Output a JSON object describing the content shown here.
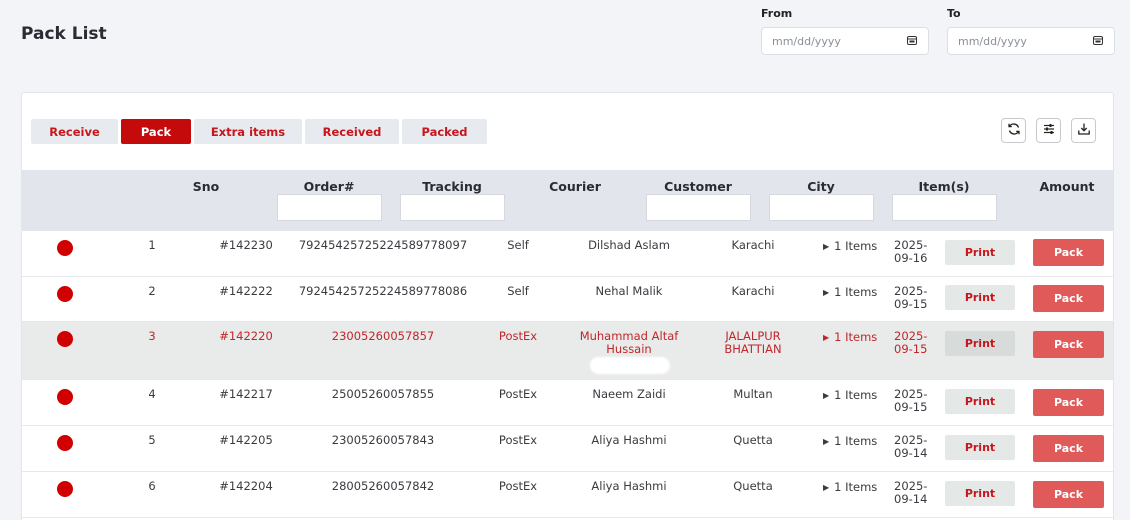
{
  "page": {
    "title": "Pack List"
  },
  "date_filter": {
    "from_label": "From",
    "to_label": "To",
    "from_placeholder": "mm/dd/yyyy",
    "to_placeholder": "mm/dd/yyyy",
    "icon": "calendar-icon"
  },
  "tabs": [
    {
      "label": "Receive",
      "active": false
    },
    {
      "label": "Pack",
      "active": true
    },
    {
      "label": "Extra items",
      "active": false
    },
    {
      "label": "Received",
      "active": false
    },
    {
      "label": "Packed",
      "active": false
    }
  ],
  "toolbar": {
    "icons": [
      "refresh-icon",
      "filter-sliders-icon",
      "download-icon"
    ]
  },
  "table": {
    "columns": [
      "Sno",
      "Order#",
      "Tracking",
      "Courier",
      "Customer",
      "City",
      "Item(s)",
      "Amount"
    ],
    "rows": [
      {
        "sno": "1",
        "order": "#142230",
        "tracking": "7924542572522458977809​7",
        "courier": "Self",
        "customer": "Dilshad Aslam",
        "city": "Karachi",
        "items": "1 Items",
        "date": "2025-\n09-16",
        "print": "Print",
        "pack": "Pack",
        "highlight": false
      },
      {
        "sno": "2",
        "order": "#142222",
        "tracking": "79245425725224589778086",
        "courier": "Self",
        "customer": "Nehal Malik",
        "city": "Karachi",
        "items": "1 Items",
        "date": "2025-\n09-15",
        "print": "Print",
        "pack": "Pack",
        "highlight": false
      },
      {
        "sno": "3",
        "order": "#142220",
        "tracking": "23005260057857",
        "courier": "PostEx",
        "customer": "Muhammad Altaf Hussain",
        "city": "JALALPUR BHATTIAN",
        "items": "1 Items",
        "date": "2025-\n09-15",
        "print": "Print",
        "pack": "Pack",
        "highlight": true
      },
      {
        "sno": "4",
        "order": "#142217",
        "tracking": "25005260057855",
        "courier": "PostEx",
        "customer": "Naeem Zaidi",
        "city": "Multan",
        "items": "1 Items",
        "date": "2025-\n09-15",
        "print": "Print",
        "pack": "Pack",
        "highlight": false
      },
      {
        "sno": "5",
        "order": "#142205",
        "tracking": "23005260057843",
        "courier": "PostEx",
        "customer": "Aliya Hashmi",
        "city": "Quetta",
        "items": "1 Items",
        "date": "2025-\n09-14",
        "print": "Print",
        "pack": "Pack",
        "highlight": false
      },
      {
        "sno": "6",
        "order": "#142204",
        "tracking": "28005260057842",
        "courier": "PostEx",
        "customer": "Aliya Hashmi",
        "city": "Quetta",
        "items": "1 Items",
        "date": "2025-\n09-14",
        "print": "Print",
        "pack": "Pack",
        "highlight": false
      }
    ]
  },
  "colors": {
    "accent": "#c40a0a",
    "status_dot": "#d00000",
    "pack_button": "#e05a5a",
    "header_bg": "#e2e5ec",
    "highlight_row": "#e8ebe9"
  }
}
